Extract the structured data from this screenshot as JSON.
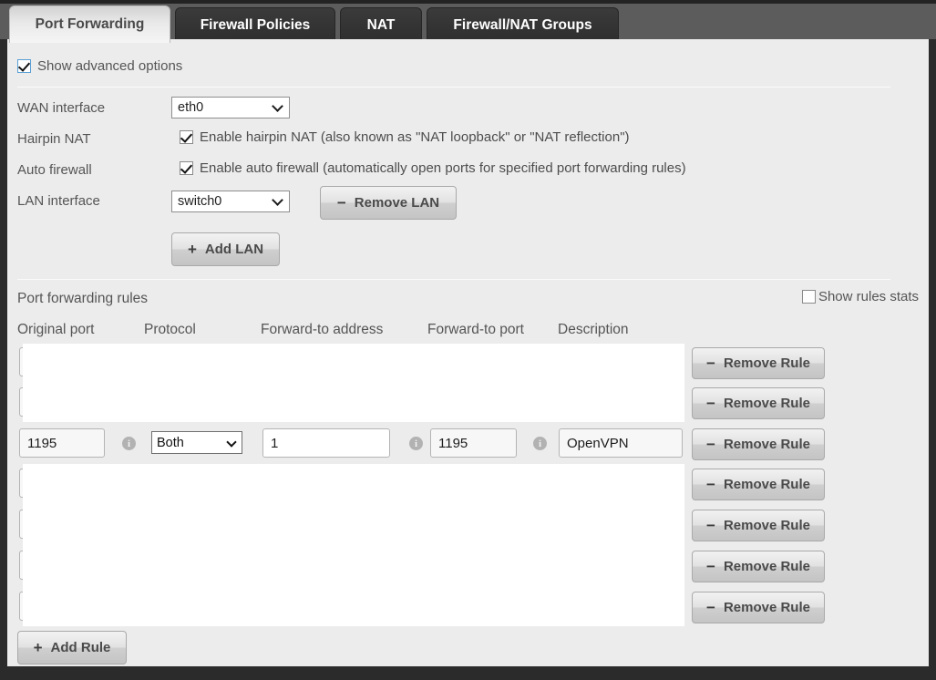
{
  "tabs": [
    {
      "label": "Port Forwarding",
      "active": true
    },
    {
      "label": "Firewall Policies",
      "active": false
    },
    {
      "label": "NAT",
      "active": false
    },
    {
      "label": "Firewall/NAT Groups",
      "active": false
    }
  ],
  "advanced": {
    "label": "Show advanced options",
    "checked": true
  },
  "settings": {
    "wan_label": "WAN interface",
    "wan_value": "eth0",
    "hairpin_label": "Hairpin NAT",
    "hairpin_text": "Enable hairpin NAT (also known as \"NAT loopback\" or \"NAT reflection\")",
    "hairpin_checked": true,
    "autofw_label": "Auto firewall",
    "autofw_text": "Enable auto firewall (automatically open ports for specified port forwarding rules)",
    "autofw_checked": true,
    "lan_label": "LAN interface",
    "lan_value": "switch0",
    "remove_lan_label": "Remove LAN",
    "remove_lan_sign": "−",
    "add_lan_label": "Add LAN",
    "add_lan_sign": "+"
  },
  "rules_section": {
    "title": "Port forwarding rules",
    "show_stats_label": "Show rules stats",
    "show_stats_checked": false,
    "columns": [
      "Original port",
      "Protocol",
      "Forward-to address",
      "Forward-to port",
      "Description"
    ],
    "remove_rule_label": "Remove Rule",
    "remove_rule_sign": "−",
    "add_rule_label": "Add Rule",
    "add_rule_sign": "+",
    "rows": [
      {
        "original_port": "",
        "protocol": "",
        "address": "",
        "forward_port": "",
        "description": "",
        "obscured": true
      },
      {
        "original_port": "",
        "protocol": "",
        "address": "",
        "forward_port": "",
        "description": "",
        "obscured": true
      },
      {
        "original_port": "1195",
        "protocol": "Both",
        "address": "1",
        "forward_port": "1195",
        "description": "OpenVPN",
        "obscured": false
      },
      {
        "original_port": "",
        "protocol": "",
        "address": "",
        "forward_port": "",
        "description": "",
        "obscured": true
      },
      {
        "original_port": "",
        "protocol": "",
        "address": "",
        "forward_port": "",
        "description": "",
        "obscured": true
      },
      {
        "original_port": "",
        "protocol": "",
        "address": "",
        "forward_port": "",
        "description": "",
        "obscured": true
      },
      {
        "original_port": "",
        "protocol": "",
        "address": "",
        "forward_port": "",
        "description": "",
        "obscured": true
      }
    ]
  },
  "icons": {
    "info": "i",
    "check": "check-icon",
    "caret": "chevron-down-icon"
  },
  "colors": {
    "page_bg": "#ececec",
    "frame": "#2b2b2b",
    "tabbar": "#5c5c5c",
    "tab_inactive": "#343434",
    "checkbox_accent": "#5a9fd4",
    "text": "#555555"
  }
}
